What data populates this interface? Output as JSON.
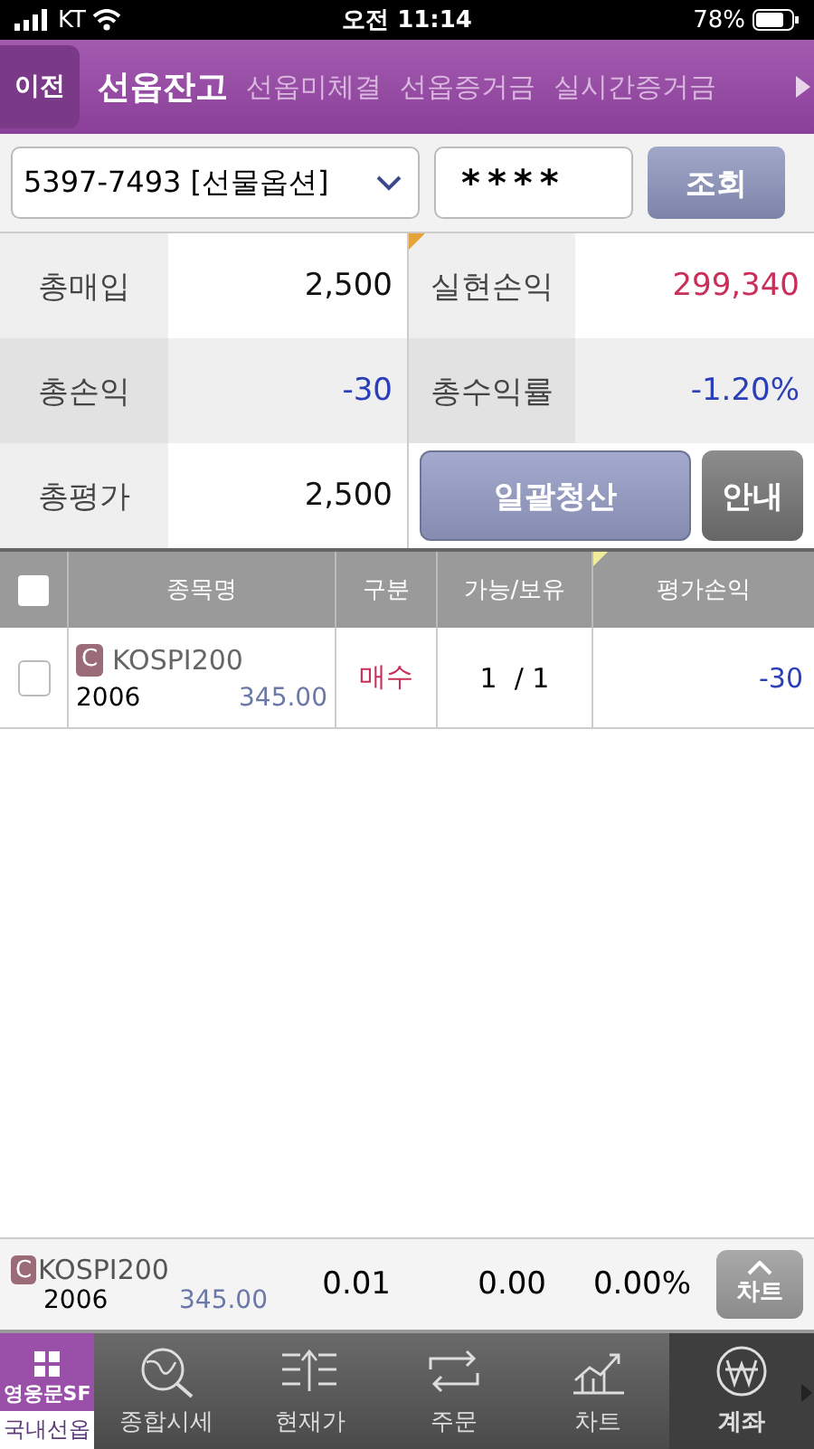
{
  "status_bar": {
    "carrier": "KT",
    "time": "오전 11:14",
    "battery": "78%"
  },
  "header": {
    "back": "이전",
    "tabs": [
      {
        "label": "선옵잔고",
        "selected": true
      },
      {
        "label": "선옵미체결",
        "selected": false
      },
      {
        "label": "선옵증거금",
        "selected": false
      },
      {
        "label": "실시간증거금",
        "selected": false
      }
    ]
  },
  "account": {
    "value": "5397-7493 [선물옵션]",
    "password": "****",
    "query_button": "조회"
  },
  "summary": [
    {
      "label": "총매입",
      "value": "2,500",
      "color": "#111111"
    },
    {
      "label": "실현손익",
      "value": "299,340",
      "color": "#c8305a"
    },
    {
      "label": "총손익",
      "value": "-30",
      "color": "#2b3fb8"
    },
    {
      "label": "총수익률",
      "value": "-1.20%",
      "color": "#2b3fb8"
    },
    {
      "label": "총평가",
      "value": "2,500",
      "color": "#111111"
    }
  ],
  "actions": {
    "liquidate": "일괄청산",
    "guide": "안내"
  },
  "table": {
    "select_all": {
      "checked": false
    },
    "columns": [
      "종목명",
      "구분",
      "가능/보유",
      "평가손익"
    ],
    "rows": [
      {
        "checked": false,
        "badge": "C",
        "name": "KOSPI200",
        "code": "2006",
        "strike": "345.00",
        "side": {
          "text": "매수",
          "color": "#c8305a"
        },
        "qty": "1  / 1",
        "pnl": {
          "text": "-30",
          "color": "#2b3fb8"
        }
      }
    ]
  },
  "quote_bar": {
    "badge": "C",
    "name": "KOSPI200",
    "code": "2006",
    "strike": "345.00",
    "price": "0.01",
    "change": "0.00",
    "rate": "0.00%",
    "chart_button": "차트"
  },
  "tab_bar": {
    "brand": "영웅문SF",
    "brand_sub": "국내선옵",
    "items": [
      {
        "label": "종합시세",
        "selected": false
      },
      {
        "label": "현재가",
        "selected": false
      },
      {
        "label": "주문",
        "selected": false
      },
      {
        "label": "차트",
        "selected": false
      },
      {
        "label": "계좌",
        "selected": true
      }
    ]
  }
}
